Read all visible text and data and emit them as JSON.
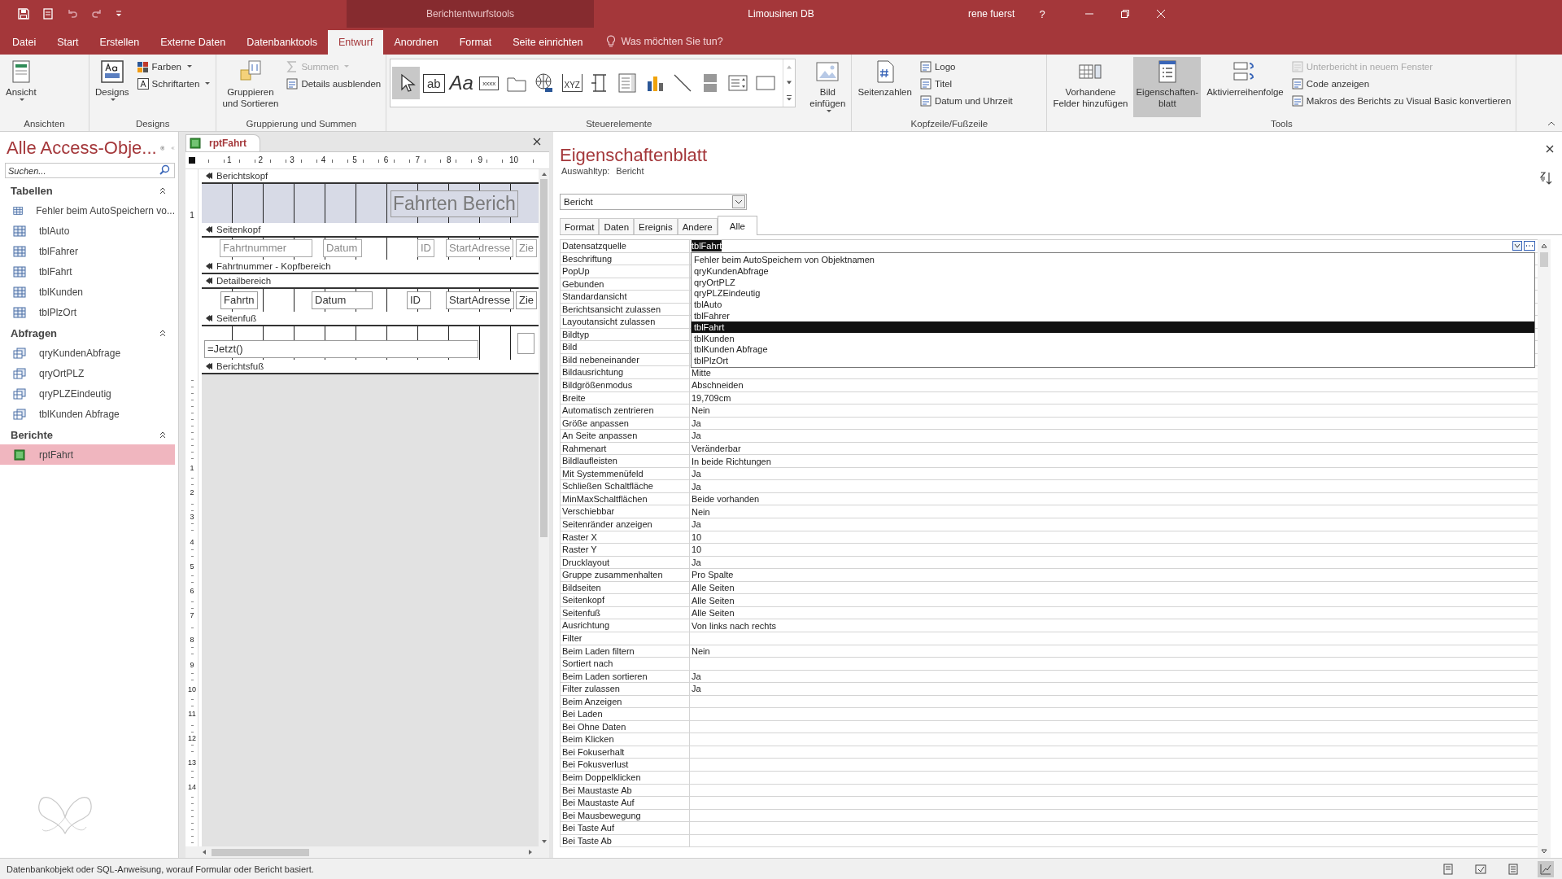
{
  "title_bar": {
    "context_title": "Berichtentwurfstools",
    "app_title": "Limousinen DB",
    "user": "rene fuerst",
    "help": "?"
  },
  "ribbon_tabs": [
    {
      "label": "Datei",
      "selected": false
    },
    {
      "label": "Start",
      "selected": false
    },
    {
      "label": "Erstellen",
      "selected": false
    },
    {
      "label": "Externe Daten",
      "selected": false
    },
    {
      "label": "Datenbanktools",
      "selected": false
    },
    {
      "label": "Entwurf",
      "selected": true
    },
    {
      "label": "Anordnen",
      "selected": false
    },
    {
      "label": "Format",
      "selected": false
    },
    {
      "label": "Seite einrichten",
      "selected": false
    }
  ],
  "tell_me": "Was möchten Sie tun?",
  "ribbon_groups": [
    {
      "label": "Ansichten",
      "items": [
        {
          "kind": "large",
          "label": "Ansicht",
          "menu": true,
          "disabled": false,
          "pressed": false
        }
      ]
    },
    {
      "label": "Designs",
      "items": [
        {
          "kind": "large",
          "label": "Designs",
          "menu": true,
          "disabled": false,
          "pressed": false
        },
        {
          "kind": "stack",
          "buttons": [
            {
              "label": "Farben",
              "menu": true,
              "disabled": false
            },
            {
              "label": "Schriftarten",
              "menu": true,
              "disabled": false
            }
          ]
        }
      ]
    },
    {
      "label": "Gruppierung und Summen",
      "items": [
        {
          "kind": "large",
          "label": "Gruppieren\nund Sortieren",
          "menu": false,
          "disabled": false,
          "pressed": false
        },
        {
          "kind": "stack",
          "buttons": [
            {
              "label": "Summen",
              "menu": true,
              "disabled": true
            },
            {
              "label": "Details ausblenden",
              "menu": false,
              "disabled": false
            }
          ]
        }
      ]
    },
    {
      "label": "Steuerelemente",
      "items": [
        {
          "kind": "gallery",
          "tools": [
            {
              "selected": true
            },
            {
              "glyph": "ab",
              "selected": false
            },
            {
              "glyph": "Aa",
              "selected": false
            },
            {
              "glyph": "xxxx",
              "selected": false
            },
            {
              "selected": false
            },
            {
              "selected": false
            },
            {
              "glyph": "XYZ",
              "selected": false
            },
            {
              "selected": false
            },
            {
              "selected": false
            },
            {
              "selected": false
            },
            {
              "selected": false
            },
            {
              "selected": false
            },
            {
              "selected": false
            },
            {
              "selected": false
            }
          ]
        },
        {
          "kind": "large",
          "label": "Bild\neinfügen",
          "menu": true,
          "disabled": false,
          "pressed": false
        }
      ]
    },
    {
      "label": "Kopfzeile/Fußzeile",
      "items": [
        {
          "kind": "large",
          "label": "Seitenzahlen",
          "menu": false,
          "disabled": false,
          "pressed": false
        },
        {
          "kind": "stack",
          "buttons": [
            {
              "label": "Logo",
              "menu": false,
              "disabled": false
            },
            {
              "label": "Titel",
              "menu": false,
              "disabled": false
            },
            {
              "label": "Datum und Uhrzeit",
              "menu": false,
              "disabled": false
            }
          ]
        }
      ]
    },
    {
      "label": "Tools",
      "items": [
        {
          "kind": "large",
          "label": "Vorhandene\nFelder hinzufügen",
          "menu": false,
          "disabled": false,
          "pressed": false
        },
        {
          "kind": "large",
          "label": "Eigenschaften-\nblatt",
          "menu": false,
          "disabled": false,
          "pressed": true
        },
        {
          "kind": "large",
          "label": "Aktivierreihenfolge",
          "menu": false,
          "disabled": false,
          "pressed": false
        },
        {
          "kind": "stack",
          "buttons": [
            {
              "label": "Unterbericht in neuem Fenster",
              "menu": false,
              "disabled": true
            },
            {
              "label": "Code anzeigen",
              "menu": false,
              "disabled": false
            },
            {
              "label": "Makros des Berichts zu Visual Basic konvertieren",
              "menu": false,
              "disabled": false
            }
          ]
        }
      ]
    }
  ],
  "nav_pane": {
    "title": "Alle Access-Obje...",
    "search": {
      "placeholder": "Suchen..."
    },
    "groups": [
      {
        "label": "Tabellen",
        "expanded": true,
        "items": [
          {
            "label": "Fehler beim AutoSpeichern vo...",
            "kind": "table",
            "selected": false
          },
          {
            "label": "tblAuto",
            "kind": "table",
            "selected": false
          },
          {
            "label": "tblFahrer",
            "kind": "table",
            "selected": false
          },
          {
            "label": "tblFahrt",
            "kind": "table",
            "selected": false
          },
          {
            "label": "tblKunden",
            "kind": "table",
            "selected": false
          },
          {
            "label": "tblPlzOrt",
            "kind": "table",
            "selected": false
          }
        ]
      },
      {
        "label": "Abfragen",
        "expanded": true,
        "items": [
          {
            "label": "qryKundenAbfrage",
            "kind": "query",
            "selected": false
          },
          {
            "label": "qryOrtPLZ",
            "kind": "query",
            "selected": false
          },
          {
            "label": "qryPLZEindeutig",
            "kind": "query",
            "selected": false
          },
          {
            "label": "tblKunden Abfrage",
            "kind": "query",
            "selected": false
          }
        ]
      },
      {
        "label": "Berichte",
        "expanded": true,
        "items": [
          {
            "label": "rptFahrt",
            "kind": "report",
            "selected": true
          }
        ]
      }
    ]
  },
  "designer": {
    "tab": "rptFahrt",
    "ruler": [
      "1",
      "2",
      "3",
      "4",
      "5",
      "6",
      "7",
      "8",
      "9",
      "10"
    ],
    "vertical_ruler": [
      "1",
      "2",
      "3",
      "4",
      "5",
      "6",
      "7",
      "8",
      "9",
      "10",
      "11",
      "12",
      "13",
      "14"
    ],
    "sections": [
      {
        "label": "Berichtskopf",
        "ruler_label": "1",
        "controls": [
          {
            "text": "Fahrten Berich",
            "kind": "title"
          }
        ]
      },
      {
        "label": "Seitenkopf",
        "controls": [
          {
            "text": "Fahrtnummer",
            "kind": "label"
          },
          {
            "text": "Datum",
            "kind": "label"
          },
          {
            "text": "ID",
            "kind": "label"
          },
          {
            "text": "StartAdresse",
            "kind": "label"
          },
          {
            "text": "Zie",
            "kind": "label"
          }
        ]
      },
      {
        "label": "Fahrtnummer - Kopfbereich"
      },
      {
        "label": "Detailbereich",
        "controls": [
          {
            "text": "Fahrtn",
            "kind": "field"
          },
          {
            "text": "Datum",
            "kind": "field"
          },
          {
            "text": "ID",
            "kind": "field"
          },
          {
            "text": "StartAdresse",
            "kind": "field"
          },
          {
            "text": "Zie",
            "kind": "field"
          }
        ]
      },
      {
        "label": "Seitenfuß",
        "controls": [
          {
            "text": "=Jetzt()",
            "kind": "field"
          },
          {
            "kind": "empty"
          }
        ]
      },
      {
        "label": "Berichtsfuß"
      }
    ]
  },
  "property_sheet": {
    "title": "Eigenschaftenblatt",
    "selection_label": "Auswahltyp:",
    "selection_type": "Bericht",
    "object": "Bericht",
    "tabs": [
      {
        "label": "Format",
        "selected": false
      },
      {
        "label": "Daten",
        "selected": false
      },
      {
        "label": "Ereignis",
        "selected": false
      },
      {
        "label": "Andere",
        "selected": false
      },
      {
        "label": "Alle",
        "selected": true
      }
    ],
    "properties": [
      {
        "name": "Datensatzquelle",
        "value": "tblFahrt",
        "editing": true
      },
      {
        "name": "Beschriftung"
      },
      {
        "name": "PopUp"
      },
      {
        "name": "Gebunden"
      },
      {
        "name": "Standardansicht"
      },
      {
        "name": "Berichtsansicht zulassen"
      },
      {
        "name": "Layoutansicht zulassen"
      },
      {
        "name": "Bildtyp"
      },
      {
        "name": "Bild"
      },
      {
        "name": "Bild nebeneinander"
      },
      {
        "name": "Bildausrichtung",
        "value": "Mitte"
      },
      {
        "name": "Bildgrößenmodus",
        "value": "Abschneiden"
      },
      {
        "name": "Breite",
        "value": "19,709cm"
      },
      {
        "name": "Automatisch zentrieren",
        "value": "Nein"
      },
      {
        "name": "Größe anpassen",
        "value": "Ja"
      },
      {
        "name": "An Seite anpassen",
        "value": "Ja"
      },
      {
        "name": "Rahmenart",
        "value": "Veränderbar"
      },
      {
        "name": "Bildlaufleisten",
        "value": "In beide Richtungen"
      },
      {
        "name": "Mit Systemmenüfeld",
        "value": "Ja"
      },
      {
        "name": "Schließen Schaltfläche",
        "value": "Ja"
      },
      {
        "name": "MinMaxSchaltflächen",
        "value": "Beide vorhanden"
      },
      {
        "name": "Verschiebbar",
        "value": "Nein"
      },
      {
        "name": "Seitenränder anzeigen",
        "value": "Ja"
      },
      {
        "name": "Raster X",
        "value": "10"
      },
      {
        "name": "Raster Y",
        "value": "10"
      },
      {
        "name": "Drucklayout",
        "value": "Ja"
      },
      {
        "name": "Gruppe zusammenhalten",
        "value": "Pro Spalte"
      },
      {
        "name": "Bildseiten",
        "value": "Alle Seiten"
      },
      {
        "name": "Seitenkopf",
        "value": "Alle Seiten"
      },
      {
        "name": "Seitenfuß",
        "value": "Alle Seiten"
      },
      {
        "name": "Ausrichtung",
        "value": "Von links nach rechts"
      },
      {
        "name": "Filter"
      },
      {
        "name": "Beim Laden filtern",
        "value": "Nein"
      },
      {
        "name": "Sortiert nach"
      },
      {
        "name": "Beim Laden sortieren",
        "value": "Ja"
      },
      {
        "name": "Filter zulassen",
        "value": "Ja"
      },
      {
        "name": "Beim Anzeigen"
      },
      {
        "name": "Bei Laden"
      },
      {
        "name": "Bei Ohne Daten"
      },
      {
        "name": "Beim Klicken"
      },
      {
        "name": "Bei Fokuserhalt"
      },
      {
        "name": "Bei Fokusverlust"
      },
      {
        "name": "Beim Doppelklicken"
      },
      {
        "name": "Bei Maustaste Ab"
      },
      {
        "name": "Bei Maustaste Auf"
      },
      {
        "name": "Bei Mausbewegung"
      },
      {
        "name": "Bei Taste Auf"
      },
      {
        "name": "Bei Taste Ab"
      }
    ],
    "dropdown": [
      {
        "label": "Fehler beim AutoSpeichern von Objektnamen",
        "selected": false
      },
      {
        "label": "qryKundenAbfrage",
        "selected": false
      },
      {
        "label": "qryOrtPLZ",
        "selected": false
      },
      {
        "label": "qryPLZEindeutig",
        "selected": false
      },
      {
        "label": "tblAuto",
        "selected": false
      },
      {
        "label": "tblFahrer",
        "selected": false
      },
      {
        "label": "tblFahrt",
        "selected": true
      },
      {
        "label": "tblKunden",
        "selected": false
      },
      {
        "label": "tblKunden Abfrage",
        "selected": false
      },
      {
        "label": "tblPlzOrt",
        "selected": false
      }
    ]
  },
  "status_bar": {
    "text": "Datenbankobjekt oder SQL-Anweisung, worauf Formular oder Bericht basiert.",
    "views": [
      {
        "selected": false
      },
      {
        "selected": false
      },
      {
        "selected": false
      },
      {
        "selected": true
      }
    ]
  }
}
